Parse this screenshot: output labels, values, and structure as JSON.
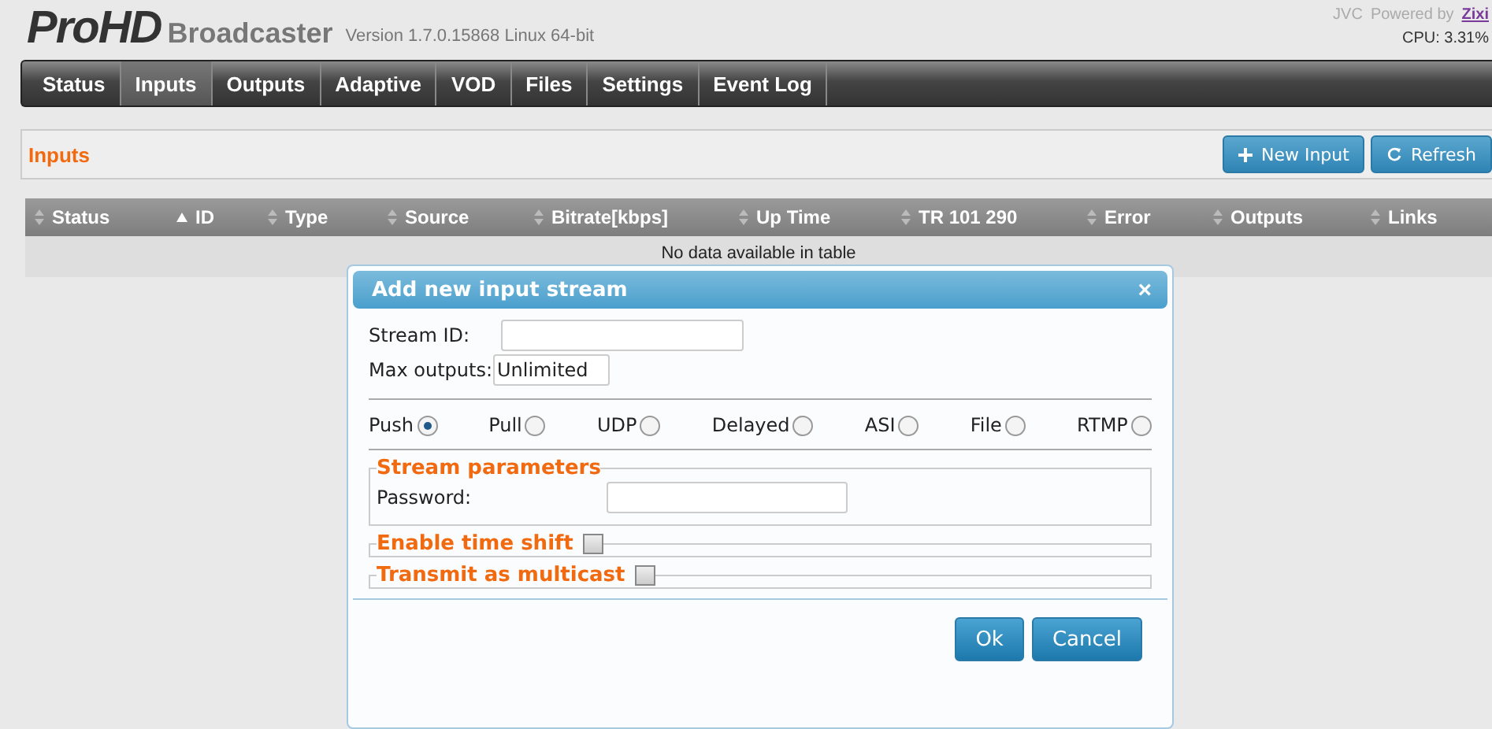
{
  "header": {
    "logo": "ProHD",
    "product": "Broadcaster",
    "version": "Version 1.7.0.15868 Linux 64-bit",
    "brand": "JVC",
    "powered_by": "Powered by",
    "partner_link": "Zixi",
    "cpu": "CPU: 3.31%"
  },
  "nav": [
    {
      "label": "Status",
      "selected": false
    },
    {
      "label": "Inputs",
      "selected": true
    },
    {
      "label": "Outputs",
      "selected": false
    },
    {
      "label": "Adaptive",
      "selected": false
    },
    {
      "label": "VOD",
      "selected": false
    },
    {
      "label": "Files",
      "selected": false
    },
    {
      "label": "Settings",
      "selected": false
    },
    {
      "label": "Event Log",
      "selected": false
    }
  ],
  "panel": {
    "title": "Inputs",
    "buttons": [
      {
        "label": "New Input",
        "kind": "add"
      },
      {
        "label": "Refresh",
        "kind": "refresh"
      }
    ]
  },
  "table": {
    "columns": [
      {
        "label": "Status",
        "sorted": false
      },
      {
        "label": "ID",
        "sorted": true
      },
      {
        "label": "Type",
        "sorted": false
      },
      {
        "label": "Source",
        "sorted": false
      },
      {
        "label": "Bitrate[kbps]",
        "sorted": false
      },
      {
        "label": "Up Time",
        "sorted": false
      },
      {
        "label": "TR 101 290",
        "sorted": false
      },
      {
        "label": "Error",
        "sorted": false
      },
      {
        "label": "Outputs",
        "sorted": false
      },
      {
        "label": "Links",
        "sorted": false
      }
    ],
    "empty_message": "No data available in table"
  },
  "dialog": {
    "title": "Add new input stream",
    "close": "×",
    "fields": [
      {
        "label": "Stream ID:"
      },
      {
        "label": "Max outputs:",
        "value": "Unlimited"
      }
    ],
    "types": [
      {
        "label": "Push",
        "selected": true
      },
      {
        "label": "Pull",
        "selected": false
      },
      {
        "label": "UDP",
        "selected": false
      },
      {
        "label": "Delayed",
        "selected": false
      },
      {
        "label": "ASI",
        "selected": false
      },
      {
        "label": "File",
        "selected": false
      },
      {
        "label": "RTMP",
        "selected": false
      }
    ],
    "stream_parameters": {
      "legend": "Stream parameters",
      "password_label": "Password:"
    },
    "options": [
      {
        "legend": "Enable time shift",
        "checked": false
      },
      {
        "legend": "Transmit as multicast",
        "checked": false
      }
    ],
    "buttons": [
      "Ok",
      "Cancel"
    ]
  }
}
